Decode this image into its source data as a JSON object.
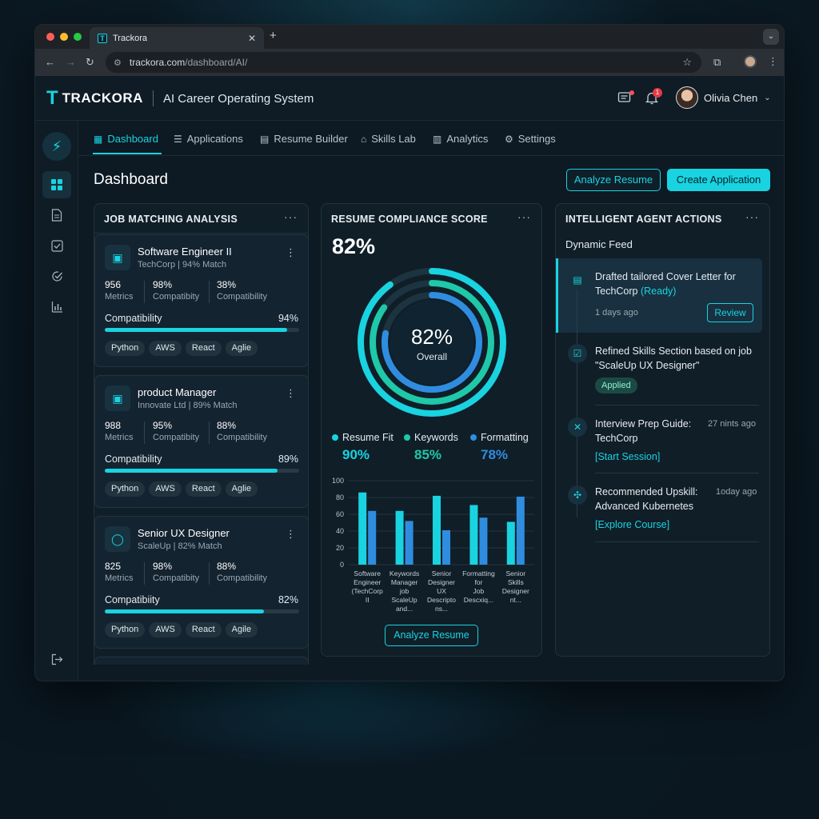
{
  "browser": {
    "tab_title": "Trackora",
    "favicon": "T",
    "url_host": "trackora.com",
    "url_path": "/dashboard/AI/"
  },
  "header": {
    "brand": "TRACKORA",
    "tagline": "AI Career Operating System",
    "notification_count": "1",
    "user_name": "Olivia Chen"
  },
  "nav": {
    "tabs": [
      {
        "label": "Dashboard",
        "icon": "grid-icon"
      },
      {
        "label": "Applications",
        "icon": "list-icon"
      },
      {
        "label": "Resume Builder",
        "icon": "document-icon"
      },
      {
        "label": "Skills Lab",
        "icon": "graduation-cap-icon"
      },
      {
        "label": "Analytics",
        "icon": "bar-chart-icon"
      },
      {
        "label": "Settings",
        "icon": "gear-icon"
      }
    ]
  },
  "page": {
    "title": "Dashboard",
    "analyze_button": "Analyze Resume",
    "create_button": "Create Application"
  },
  "job_matching": {
    "title": "JOB MATCHING ANALYSIS",
    "cards": [
      {
        "title": "Software Engineer II",
        "subtitle": "TechCorp | 94% Match",
        "metrics": [
          {
            "value": "956",
            "label": "Metrics"
          },
          {
            "value": "98%",
            "label": "Compatibity"
          },
          {
            "value": "38%",
            "label": "Compatibility"
          }
        ],
        "compat_label": "Compatibility",
        "compat_value": "94%",
        "compat_fraction": 0.94,
        "skills": [
          "Python",
          "AWS",
          "React",
          "Aglie"
        ]
      },
      {
        "title": "product Manager",
        "subtitle": "Innovate Ltd | 89% Match",
        "metrics": [
          {
            "value": "988",
            "label": "Metrics"
          },
          {
            "value": "95%",
            "label": "Compatibity"
          },
          {
            "value": "88%",
            "label": "Compatibility"
          }
        ],
        "compat_label": "Compatibility",
        "compat_value": "89%",
        "compat_fraction": 0.89,
        "skills": [
          "Python",
          "AWS",
          "React",
          "Aglie"
        ]
      },
      {
        "title": "Senior UX Designer",
        "subtitle": "ScaleUp | 82% Match",
        "metrics": [
          {
            "value": "825",
            "label": "Metrics"
          },
          {
            "value": "98%",
            "label": "Compatibity"
          },
          {
            "value": "88%",
            "label": "Compatibility"
          }
        ],
        "compat_label": "Compatibiity",
        "compat_value": "82%",
        "compat_fraction": 0.82,
        "skills": [
          "Python",
          "AWS",
          "React",
          "Agile"
        ]
      }
    ]
  },
  "compliance": {
    "title": "RESUME COMPLIANCE SCORE",
    "score": "82%",
    "ring_score": "82%",
    "ring_label": "Overall",
    "legend": [
      {
        "name": "Resume Fit",
        "value": "90%",
        "color": "#19d3e0"
      },
      {
        "name": "Keywords",
        "value": "85%",
        "color": "#1ec8a8"
      },
      {
        "name": "Formatting",
        "value": "78%",
        "color": "#2f8de0"
      }
    ],
    "analyze_button": "Analyze Resume"
  },
  "chart_data": {
    "type": "bar",
    "ylim": [
      0,
      100
    ],
    "yticks": [
      "0",
      "20",
      "40",
      "60",
      "80",
      "100"
    ],
    "categories": [
      [
        "Software",
        "Engineer",
        "(TechCorp",
        "II"
      ],
      [
        "Keywords",
        "Manager",
        "job",
        "ScaleUp",
        "and..."
      ],
      [
        "Senior",
        "Designer",
        "UX",
        "Descripto",
        "ns..."
      ],
      [
        "Formatting",
        "for",
        "Job",
        "Descxiq..."
      ],
      [
        "Senior",
        "Skills",
        "Designer",
        "nt..."
      ]
    ],
    "series": [
      {
        "values": [
          86,
          64,
          82,
          71,
          51
        ],
        "color": "#19d3e0"
      },
      {
        "values": [
          64,
          52,
          41,
          56,
          81
        ],
        "color": "#2f8de0"
      }
    ]
  },
  "agent": {
    "title": "INTELLIGENT AGENT ACTIONS",
    "feed_label": "Dynamic Feed",
    "items": [
      {
        "text": "Drafted tailored Cover Letter for TechCorp",
        "status": "(Ready)",
        "time": "1 days ago",
        "button": "Review"
      },
      {
        "text": "Refined Skills Section based on job \"ScaleUp UX Designer\"",
        "badge": "Applied"
      },
      {
        "text": "Interview Prep Guide: TechCorp",
        "time": "27 nints ago",
        "link": "[Start Session]"
      },
      {
        "text": "Recommended Upskill: Advanced Kubernetes",
        "time": "1oday ago",
        "link": "[Explore Course]"
      }
    ]
  }
}
